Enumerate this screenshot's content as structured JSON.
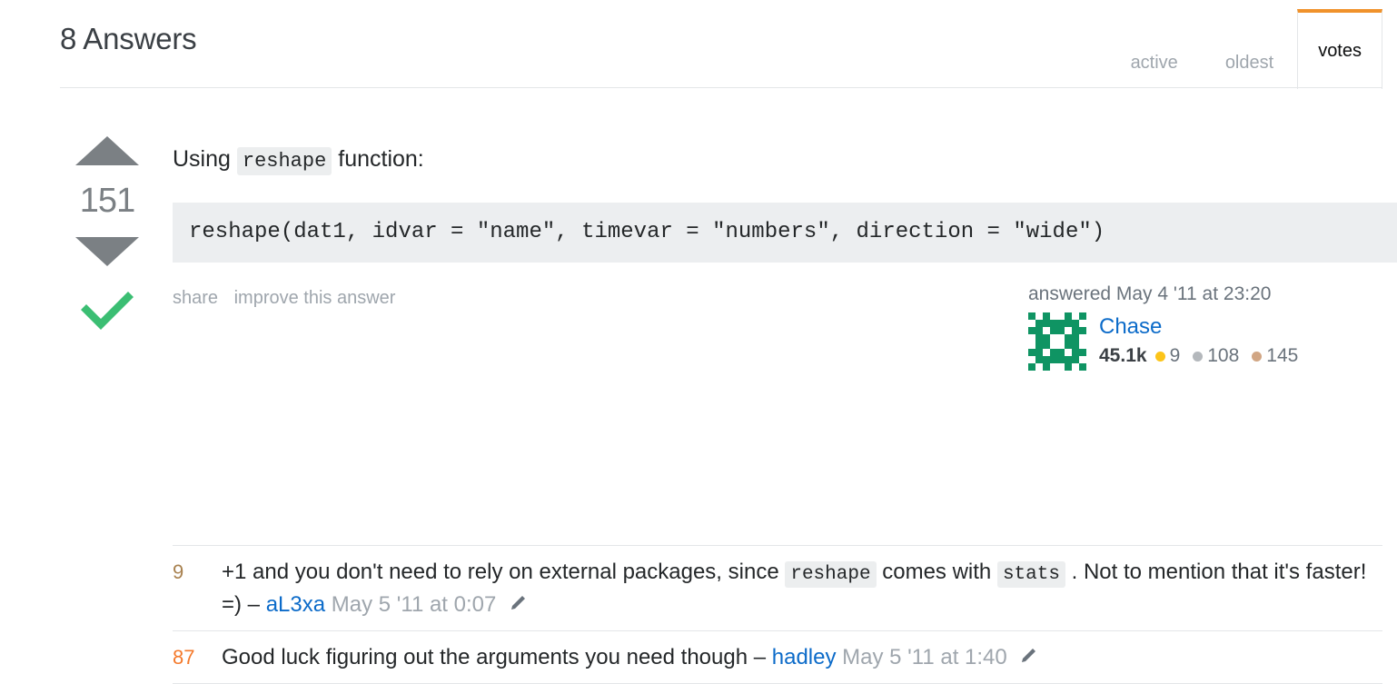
{
  "header": {
    "title": "8 Answers",
    "tabs": [
      {
        "label": "active",
        "active": false
      },
      {
        "label": "oldest",
        "active": false
      },
      {
        "label": "votes",
        "active": true
      }
    ]
  },
  "answer": {
    "vote_count": "151",
    "upvote_icon": "triangle-up-icon",
    "downvote_icon": "triangle-down-icon",
    "accepted_icon": "checkmark-icon",
    "accepted_color": "#3bbe73",
    "body": {
      "intro_before": "Using",
      "intro_code": "reshape",
      "intro_after": "function:",
      "code": "reshape(dat1, idvar = \"name\", timevar = \"numbers\", direction = \"wide\")"
    },
    "menu": {
      "share": "share",
      "improve": "improve this answer"
    },
    "user": {
      "answered": "answered May 4 '11 at 23:20",
      "name": "Chase",
      "reputation": "45.1k",
      "gold": "9",
      "silver": "108",
      "bronze": "145",
      "avatar_icon": "identicon-avatar",
      "avatar_color": "#0f9463",
      "name_color": "#0c6bc9"
    }
  },
  "comments": [
    {
      "score": "9",
      "score_color": "#a8814f",
      "text_1": "+1 and you don't need to rely on external packages, since",
      "code_1": "reshape",
      "text_2": "comes with",
      "code_2": "stats",
      "text_3": ". Not to mention that it's faster! =) –",
      "user": "aL3xa",
      "date": "May 5 '11 at 0:07",
      "edit_icon": "pencil-icon"
    },
    {
      "score": "87",
      "score_color": "#f4792b",
      "text_1": "Good luck figuring out the arguments you need though –",
      "code_1": "",
      "text_2": "",
      "code_2": "",
      "text_3": "",
      "user": "hadley",
      "date": "May 5 '11 at 1:40",
      "edit_icon": "pencil-icon"
    }
  ]
}
